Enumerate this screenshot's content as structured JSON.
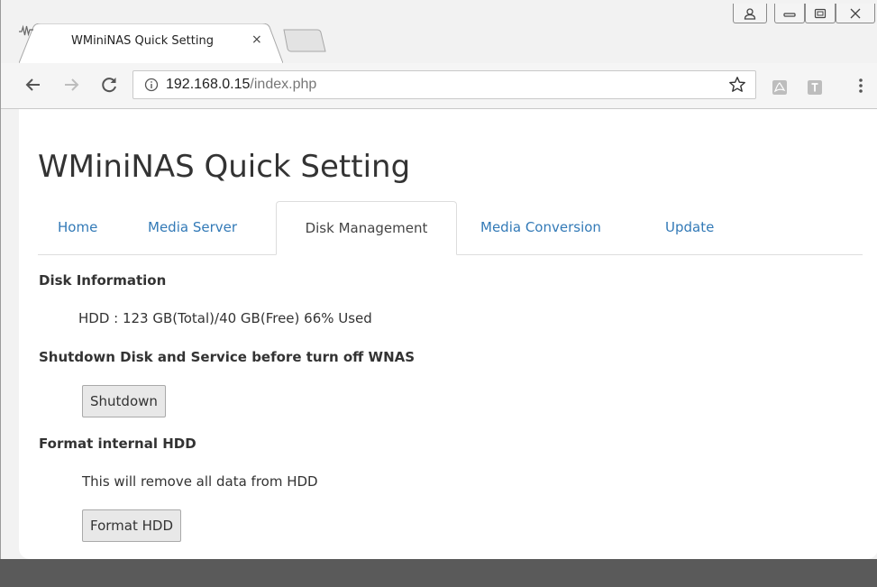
{
  "browser": {
    "tab_title": "WMiniNAS Quick Setting",
    "tab_close": "×",
    "url_host": "192.168.0.15",
    "url_path": "/index.php",
    "menu_dots": "⋮"
  },
  "page": {
    "title": "WMiniNAS Quick Setting",
    "tabs": [
      {
        "label": "Home"
      },
      {
        "label": "Media Server"
      },
      {
        "label": "Disk Management",
        "active": true
      },
      {
        "label": "Media Conversion"
      },
      {
        "label": "Update"
      }
    ],
    "disk_info_heading": "Disk Information",
    "disk_info_text": "HDD : 123 GB(Total)/40 GB(Free) 66% Used",
    "shutdown_heading": "Shutdown Disk and Service before turn off WNAS",
    "shutdown_button": "Shutdown",
    "format_heading": "Format internal HDD",
    "format_text": "This will remove all data from HDD",
    "format_button": "Format HDD"
  }
}
